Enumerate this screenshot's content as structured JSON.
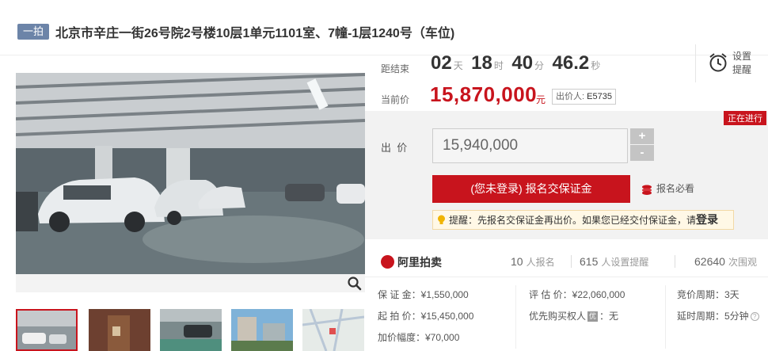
{
  "header": {
    "tag": "一拍",
    "title": "北京市辛庄一街26号院2号楼10层1单元1101室、7幢-1层1240号（车位)"
  },
  "countdown": {
    "label": "距结束",
    "days": "02",
    "days_unit": "天",
    "hours": "18",
    "hours_unit": "时",
    "minutes": "40",
    "minutes_unit": "分",
    "seconds": "46.2",
    "seconds_unit": "秒"
  },
  "remind": {
    "label": "设置提醒"
  },
  "current_price": {
    "label": "当前价",
    "value": "15,870,000",
    "unit": "元",
    "bidder_label": "出价人:",
    "bidder_id": "E5735"
  },
  "bid": {
    "status": "正在进行",
    "label": "出  价",
    "input_value": "15,940,000",
    "plus": "+",
    "minus": "-",
    "signup_button": "(您未登录) 报名交保证金",
    "must_read": "报名必看",
    "tip_text": "提醒：先报名交保证金再出价。如果您已经交付保证金，请",
    "tip_login": "登录"
  },
  "stats": {
    "brand": "阿里拍卖",
    "registrations": "10",
    "registrations_unit": "人报名",
    "reminders": "615",
    "reminders_unit": "人设置提醒",
    "views": "62640",
    "views_unit": "次围观"
  },
  "details": {
    "deposit": "保 证 金：¥1,550,000",
    "start_price": "起 拍 价：¥15,450,000",
    "increment": "加价幅度：¥70,000",
    "appraisal": "评 估 价：¥22,060,000",
    "priority_label": "优先购买权人",
    "priority_tag": "优",
    "priority_value": "：无",
    "cycle": "竞价周期：3天",
    "delay": "延时周期：5分钟"
  },
  "colors": {
    "accent": "#c8141d",
    "tag": "#6c84a8"
  }
}
